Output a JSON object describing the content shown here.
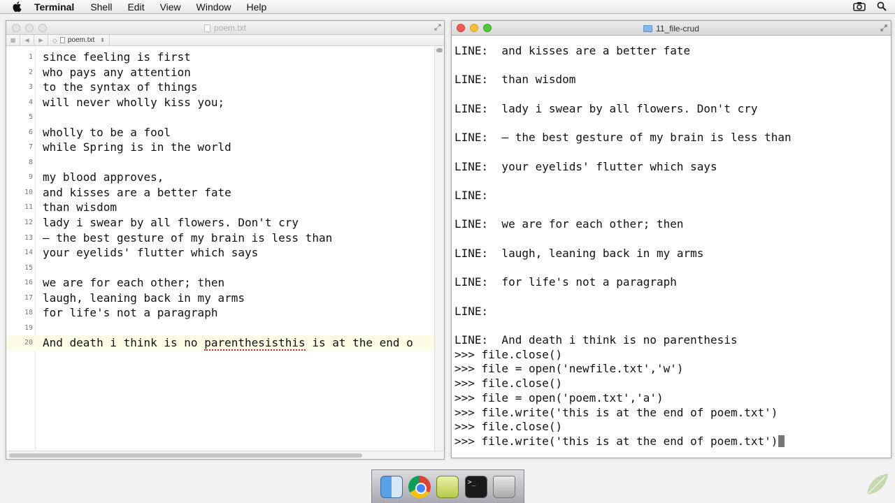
{
  "menubar": {
    "apple_icon": "apple-icon",
    "items": [
      "Terminal",
      "Shell",
      "Edit",
      "View",
      "Window",
      "Help"
    ],
    "right_icons": [
      "camera-icon",
      "search-icon"
    ]
  },
  "editor": {
    "title": "poem.txt",
    "toolbar": {
      "back": "◀",
      "forward": "▶",
      "breadcrumb": "poem.txt"
    },
    "lines": [
      {
        "num": "1",
        "text": "since feeling is first"
      },
      {
        "num": "2",
        "text": "who pays any attention"
      },
      {
        "num": "3",
        "text": "to the syntax of things"
      },
      {
        "num": "4",
        "text": "will never wholly kiss you;"
      },
      {
        "num": "5",
        "text": ""
      },
      {
        "num": "6",
        "text": "wholly to be a fool"
      },
      {
        "num": "7",
        "text": "while Spring is in the world"
      },
      {
        "num": "8",
        "text": ""
      },
      {
        "num": "9",
        "text": "my blood approves,"
      },
      {
        "num": "10",
        "text": "and kisses are a better fate"
      },
      {
        "num": "11",
        "text": "than wisdom"
      },
      {
        "num": "12",
        "text": "lady i swear by all flowers. Don't cry"
      },
      {
        "num": "13",
        "text": "– the best gesture of my brain is less than"
      },
      {
        "num": "14",
        "text": "your eyelids' flutter which says"
      },
      {
        "num": "15",
        "text": ""
      },
      {
        "num": "16",
        "text": "we are for each other; then"
      },
      {
        "num": "17",
        "text": "laugh, leaning back in my arms"
      },
      {
        "num": "18",
        "text": "for life's not a paragraph"
      },
      {
        "num": "19",
        "text": ""
      },
      {
        "num": "20",
        "text_before": "And death i think is no ",
        "text_misspelled": "parenthesisthis",
        "text_after": " is at the end o"
      }
    ]
  },
  "terminal": {
    "title": "11_file-crud",
    "lines": [
      "LINE:  and kisses are a better fate",
      "",
      "LINE:  than wisdom",
      "",
      "LINE:  lady i swear by all flowers. Don't cry",
      "",
      "LINE:  – the best gesture of my brain is less than",
      "",
      "LINE:  your eyelids' flutter which says",
      "",
      "LINE:",
      "",
      "LINE:  we are for each other; then",
      "",
      "LINE:  laugh, leaning back in my arms",
      "",
      "LINE:  for life's not a paragraph",
      "",
      "LINE:",
      "",
      "LINE:  And death i think is no parenthesis",
      ">>> file.close()",
      ">>> file = open('newfile.txt','w')",
      ">>> file.close()",
      ">>> file = open('poem.txt','a')",
      ">>> file.write('this is at the end of poem.txt')",
      ">>> file.close()",
      ">>> file.write('this is at the end of poem.txt')"
    ]
  },
  "dock": {
    "apps": [
      "finder-icon",
      "chrome-icon",
      "wing-ide-icon",
      "terminal-icon",
      "trash-icon"
    ]
  }
}
